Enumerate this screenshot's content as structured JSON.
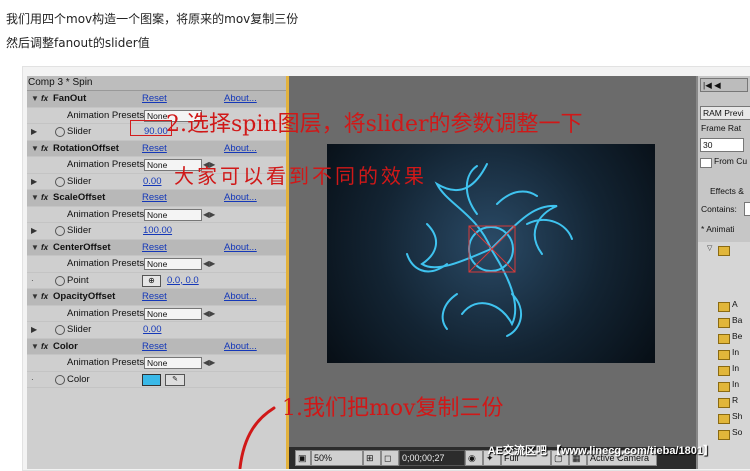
{
  "intro": {
    "line1": "我们用四个mov构造一个图案，将原来的mov复制三份",
    "line2": "然后调整fanout的slider值"
  },
  "effect_panel": {
    "title": "Comp 3 * Spin",
    "reset_label": "Reset",
    "about_label": "About...",
    "presets_label": "Animation Presets:",
    "presets_value": "None",
    "effects": [
      {
        "name": "FanOut",
        "param_label": "Slider",
        "param_value": "90.00"
      },
      {
        "name": "RotationOffset",
        "param_label": "Slider",
        "param_value": "0.00"
      },
      {
        "name": "ScaleOffset",
        "param_label": "Slider",
        "param_value": "100.00"
      },
      {
        "name": "CenterOffset",
        "param_label": "Point",
        "param_value": "0.0, 0.0"
      },
      {
        "name": "OpacityOffset",
        "param_label": "Slider",
        "param_value": "0.00"
      },
      {
        "name": "Color",
        "param_label": "Color",
        "swatch_color": "#3ab9e8"
      }
    ]
  },
  "comp_toolbar": {
    "zoom": "50%",
    "timecode": "0;00;00;27",
    "resolution": "Full",
    "view": "Active Camera"
  },
  "right_panel": {
    "preview_select": "RAM Previ",
    "frame_rate_label": "Frame Rat",
    "frame_rate_value": "30",
    "from_current_label": "From Cu",
    "effects_tab": "Effects &",
    "contains_label": "Contains:",
    "tree_root": "* Animati",
    "folders": [
      "A",
      "Ba",
      "Be",
      "In",
      "In",
      "In",
      "R",
      "Sh",
      "So"
    ]
  },
  "annotations": {
    "step2": "2.选择spin图层，将slider的参数调整一下",
    "step2_sub": "大家可以看到不同的效果",
    "step1": "1.我们把mov复制三份"
  },
  "watermark": "AE交流区吧 【www.linecg.com/tieba/1801】",
  "colors": {
    "annotation": "#d01818",
    "accent_border": "#e3b23c",
    "link": "#1538b8",
    "swatch": "#3ab9e8"
  }
}
